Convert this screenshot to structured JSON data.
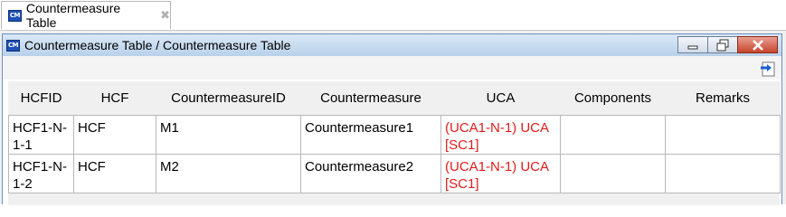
{
  "tab": {
    "icon": "cm-document-icon",
    "label": "Countermeasure Table",
    "close_icon": "close-x-icon"
  },
  "window": {
    "title": "Countermeasure Table / Countermeasure Table",
    "buttons": [
      "minimize",
      "restore",
      "close"
    ]
  },
  "toolbar": {
    "export_icon": "export-arrow-icon"
  },
  "table": {
    "columns": [
      "HCFID",
      "HCF",
      "CountermeasureID",
      "Countermeasure",
      "UCA",
      "Components",
      "Remarks"
    ],
    "rows": [
      [
        "HCF1-N-1-1",
        "HCF",
        "M1",
        "Countermeasure1",
        "(UCA1-N-1) UCA [SC1]",
        "",
        ""
      ],
      [
        "HCF1-N-1-2",
        "HCF",
        "M2",
        "Countermeasure2",
        "(UCA1-N-1) UCA [SC1]",
        "",
        ""
      ]
    ]
  },
  "colors": {
    "uca_text": "#e01b1b",
    "title_gradient_top": "#d9e8f7",
    "title_gradient_bottom": "#b9d1ea"
  }
}
